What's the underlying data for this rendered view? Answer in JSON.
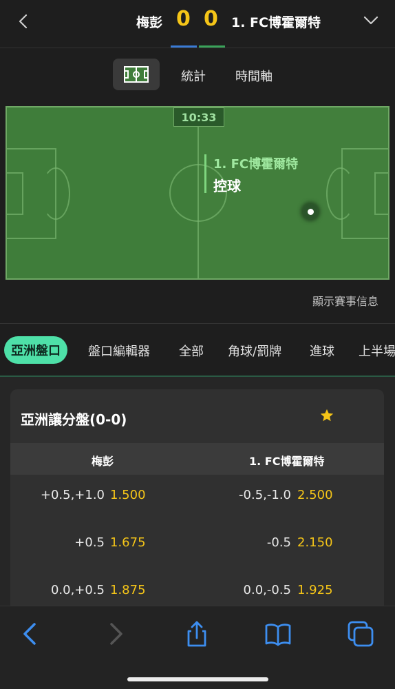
{
  "header": {
    "home_team": "梅彭",
    "home_score": "0",
    "away_score": "0",
    "away_team": "1. FC博霍爾特"
  },
  "view_tabs": {
    "pitch_icon": "pitch-icon",
    "stats": "統計",
    "timeline": "時間軸"
  },
  "pitch": {
    "clock": "10:33",
    "possession_team": "1. FC博霍爾特",
    "possession_label": "控球"
  },
  "show_match_info": "顯示賽事信息",
  "market_tabs": [
    "亞洲盤口",
    "盤口編輯器",
    "全部",
    "角球/罰牌",
    "進球",
    "上半場"
  ],
  "market": {
    "title": "亞洲讓分盤(0-0)",
    "home_col": "梅彭",
    "away_col": "1. FC博霍爾特",
    "rows": [
      {
        "home_hc": "+0.5,+1.0",
        "home_price": "1.500",
        "away_hc": "-0.5,-1.0",
        "away_price": "2.500"
      },
      {
        "home_hc": "+0.5",
        "home_price": "1.675",
        "away_hc": "-0.5",
        "away_price": "2.150"
      },
      {
        "home_hc": "0.0,+0.5",
        "home_price": "1.875",
        "away_hc": "0.0,-0.5",
        "away_price": "1.925"
      }
    ]
  },
  "colors": {
    "accent_yellow": "#f5c518",
    "active_tab": "#4ee0a8",
    "ios_blue": "#3d8ef0",
    "pitch_green": "#3f7d3a"
  }
}
